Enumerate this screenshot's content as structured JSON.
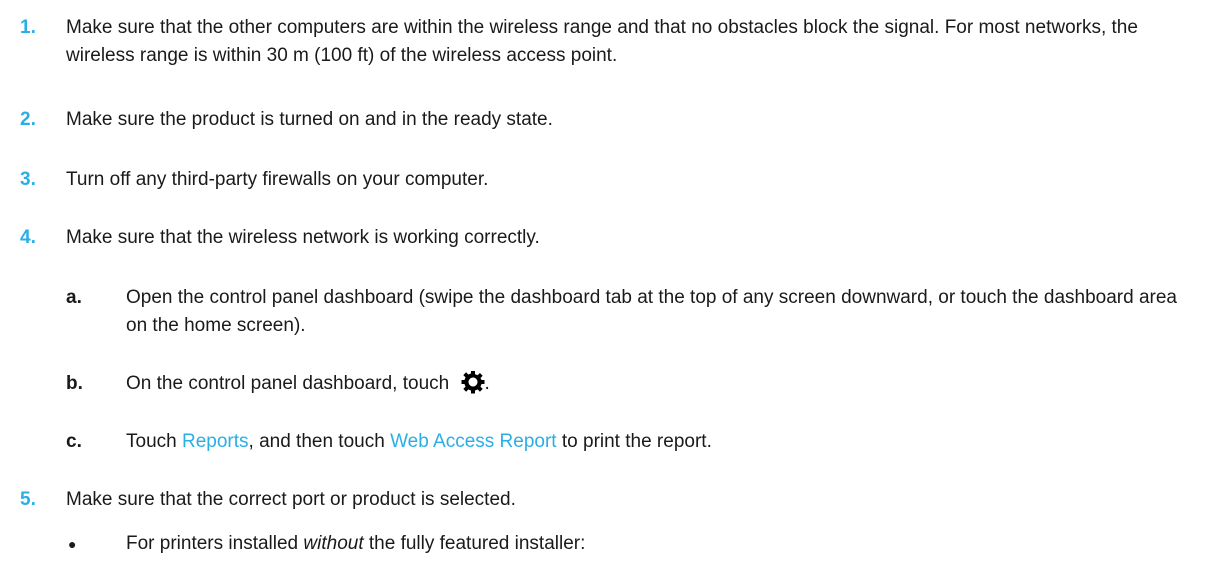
{
  "steps": [
    {
      "num": "1.",
      "text": "Make sure that the other computers are within the wireless range and that no obstacles block the signal. For most networks, the wireless range is within 30 m (100 ft) of the wireless access point."
    },
    {
      "num": "2.",
      "text": "Make sure the product is turned on and in the ready state."
    },
    {
      "num": "3.",
      "text": "Turn off any third-party firewalls on your computer."
    },
    {
      "num": "4.",
      "text": "Make sure that the wireless network is working correctly."
    },
    {
      "num": "5.",
      "text": "Make sure that the correct port or product is selected."
    }
  ],
  "substeps": {
    "a": {
      "num": "a.",
      "text": "Open the control panel dashboard (swipe the dashboard tab at the top of any screen downward, or touch the dashboard area on the home screen)."
    },
    "b": {
      "num": "b.",
      "text_before": "On the control panel dashboard, touch",
      "icon": "gear-icon",
      "text_after": "."
    },
    "c": {
      "num": "c.",
      "text_1": "Touch",
      "link_1": "Reports",
      "text_2": ", and then touch",
      "link_2": "Web Access Report",
      "text_3": "to print the report."
    }
  },
  "bullet": {
    "symbol": "●",
    "text_1": "For printers installed",
    "text_em": "without",
    "text_2": "the fully featured installer:"
  },
  "colors": {
    "accent": "#2aaee6",
    "text": "#1a1a1a"
  }
}
